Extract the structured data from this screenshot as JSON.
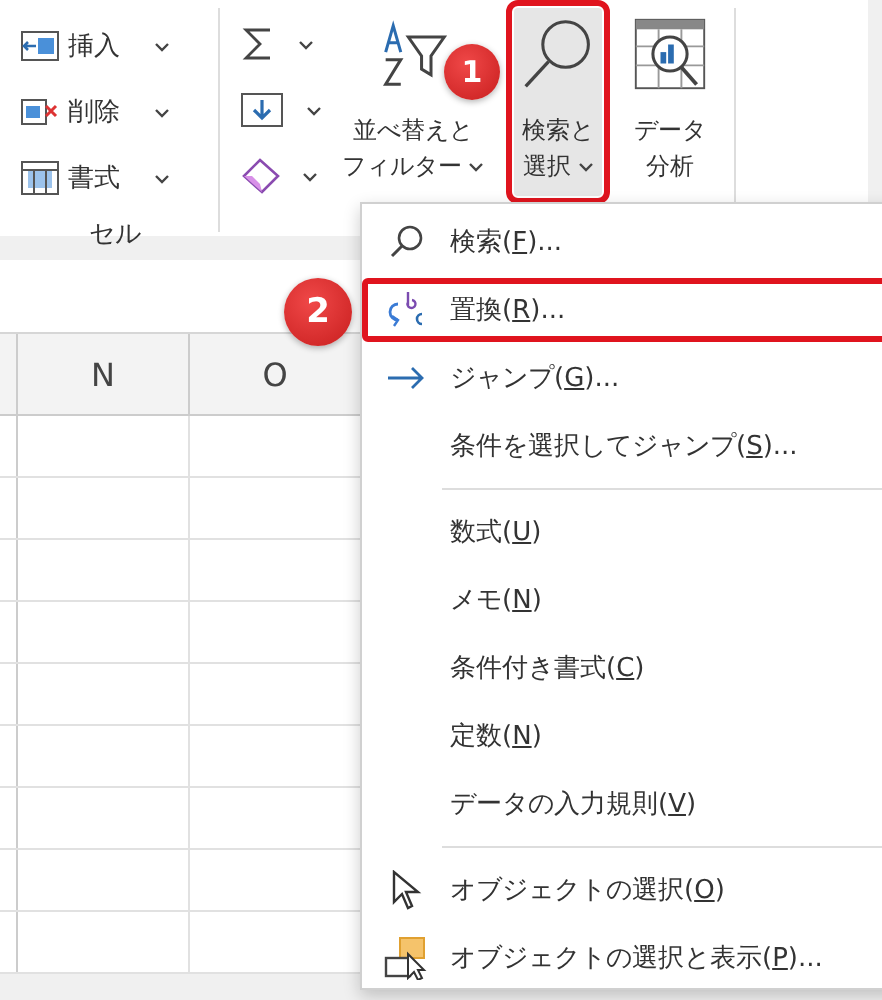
{
  "ribbon": {
    "cells_group": {
      "label": "セル",
      "items": [
        {
          "kind": "insert",
          "label": "挿入",
          "dropdown": true
        },
        {
          "kind": "delete",
          "label": "削除",
          "dropdown": true
        },
        {
          "kind": "format",
          "label": "書式",
          "dropdown": true
        }
      ]
    },
    "edit_tools": [
      {
        "kind": "sum",
        "dropdown": true
      },
      {
        "kind": "fill",
        "dropdown": true
      },
      {
        "kind": "clear",
        "dropdown": true
      }
    ],
    "large_buttons": [
      {
        "kind": "sort_filter",
        "lines": [
          "並べ替えと",
          "フィルター"
        ],
        "dropdown": true,
        "highlighted": false
      },
      {
        "kind": "find",
        "lines": [
          "検索と",
          "選択"
        ],
        "dropdown": true,
        "highlighted": true,
        "callout": "1"
      },
      {
        "kind": "analysis",
        "lines": [
          "データ",
          "分析"
        ],
        "dropdown": false,
        "highlighted": false
      }
    ]
  },
  "columns": [
    "N",
    "O"
  ],
  "menu": {
    "groups": [
      [
        {
          "kind": "search",
          "before": "検索(",
          "key": "F",
          "after": ")...",
          "highlighted": false
        },
        {
          "kind": "replace",
          "before": "置換(",
          "key": "R",
          "after": ")...",
          "highlighted": true,
          "callout": "2"
        },
        {
          "kind": "goto",
          "before": "ジャンプ(",
          "key": "G",
          "after": ")...",
          "highlighted": false
        },
        {
          "kind": "plain",
          "before": "条件を選択してジャンプ(",
          "key": "S",
          "after": ")...",
          "highlighted": false
        }
      ],
      [
        {
          "kind": "plain",
          "before": "数式(",
          "key": "U",
          "after": ")",
          "highlighted": false
        },
        {
          "kind": "plain",
          "before": "メモ(",
          "key": "N",
          "after": ")",
          "highlighted": false
        },
        {
          "kind": "plain",
          "before": "条件付き書式(",
          "key": "C",
          "after": ")",
          "highlighted": false
        },
        {
          "kind": "plain",
          "before": "定数(",
          "key": "N",
          "after": ")",
          "highlighted": false
        },
        {
          "kind": "plain",
          "before": "データの入力規則(",
          "key": "V",
          "after": ")",
          "highlighted": false
        }
      ],
      [
        {
          "kind": "pointer",
          "before": "オブジェクトの選択(",
          "key": "O",
          "after": ")",
          "highlighted": false
        },
        {
          "kind": "pane",
          "before": "オブジェクトの選択と表示(",
          "key": "P",
          "after": ")...",
          "highlighted": false
        }
      ]
    ]
  }
}
